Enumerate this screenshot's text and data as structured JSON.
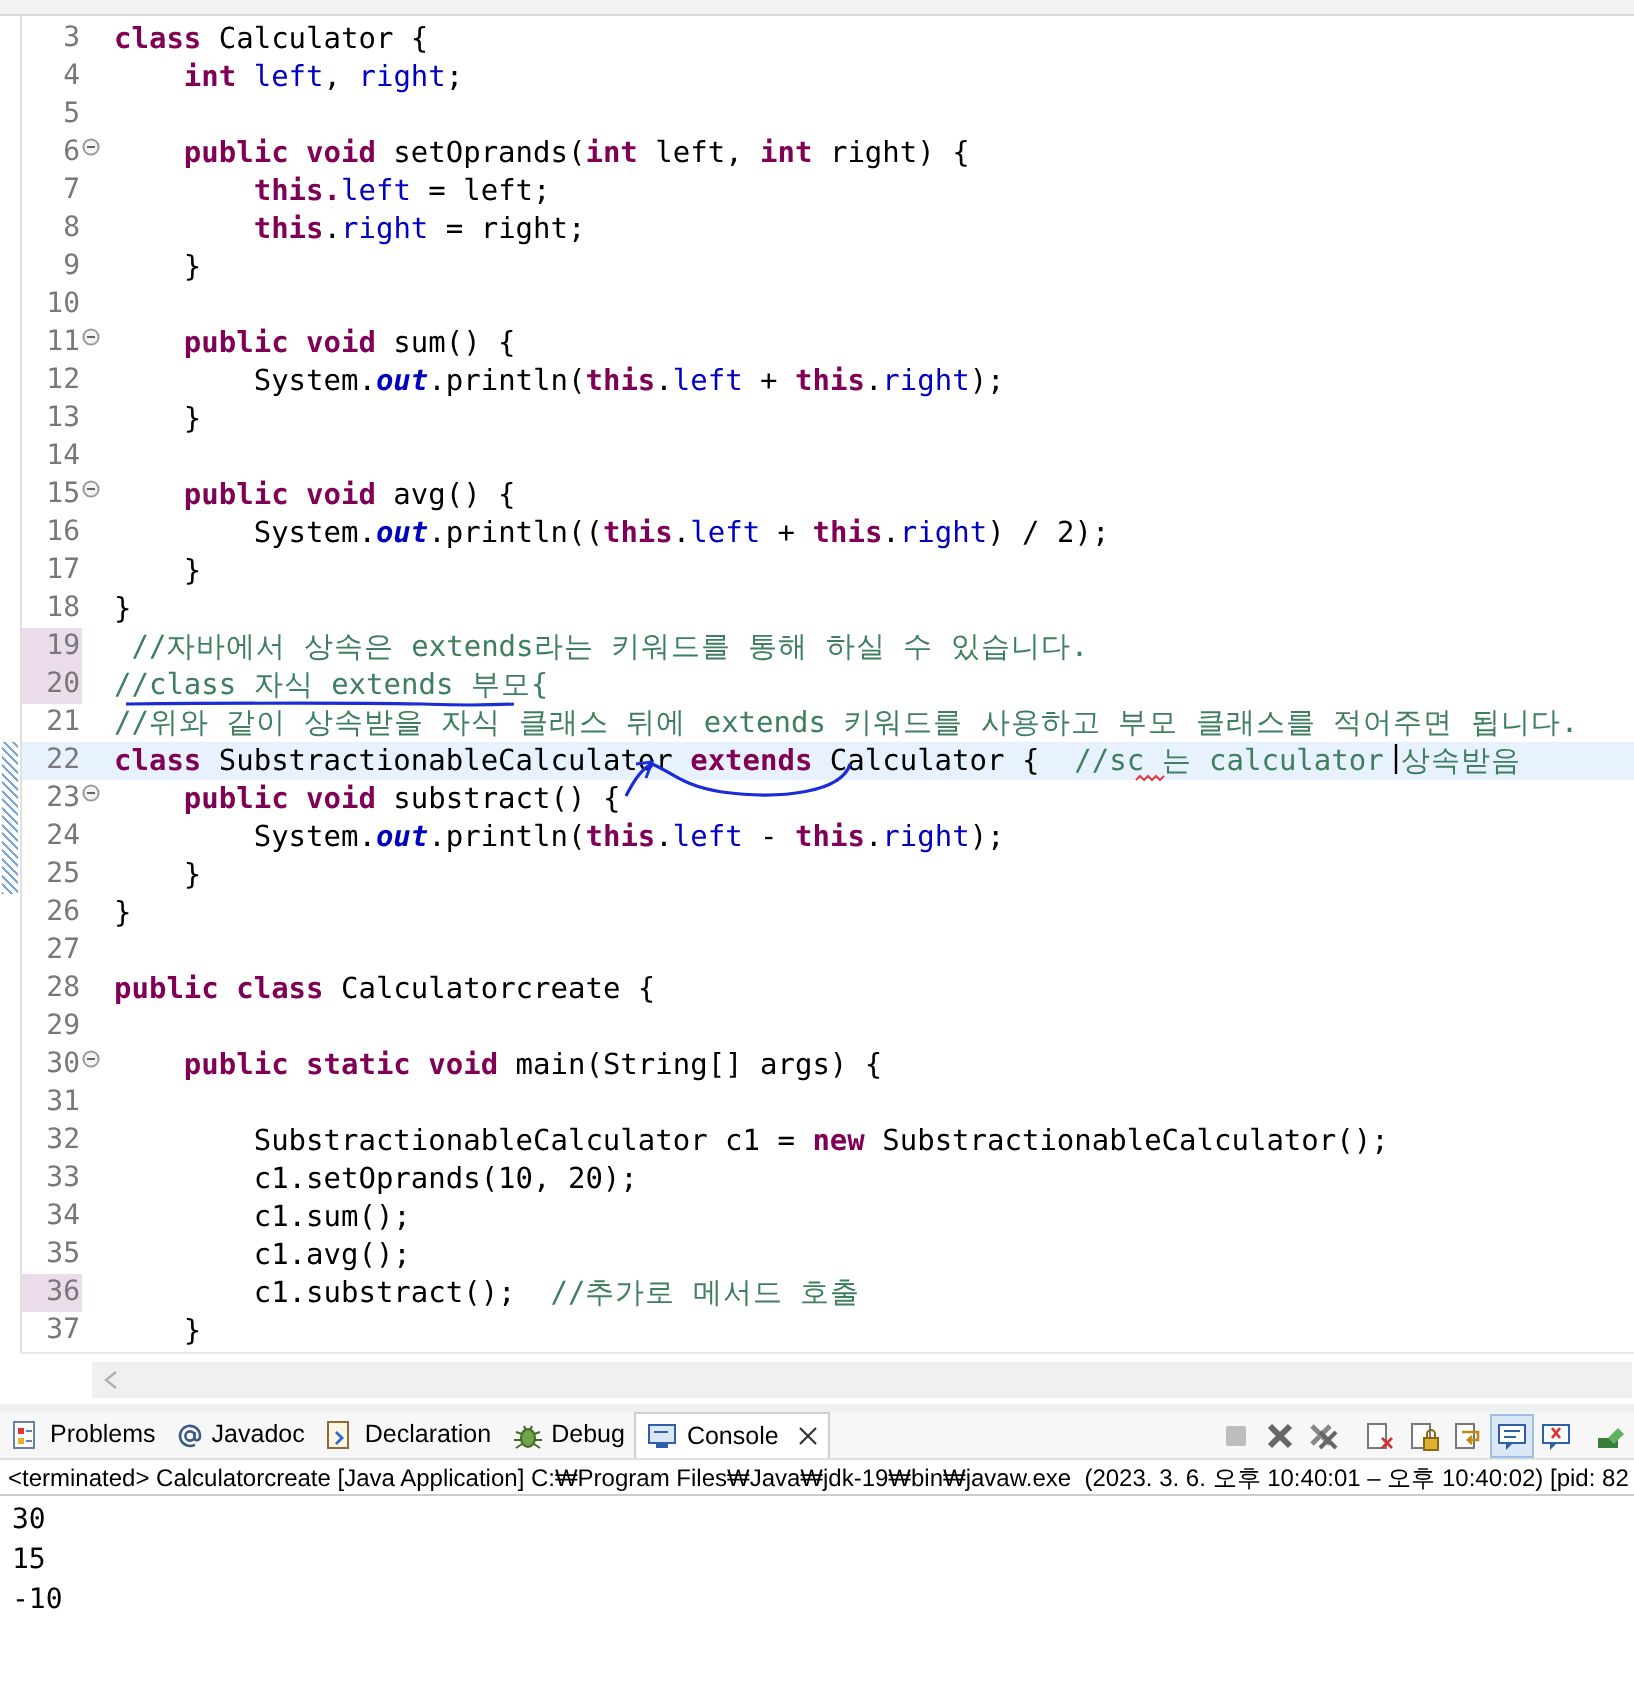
{
  "editor": {
    "lines": [
      {
        "number": "3",
        "fold": false,
        "changed": false,
        "current": false,
        "tokens": [
          {
            "kind": "keyword",
            "text": "class"
          },
          {
            "kind": "plain",
            "text": " Calculator {"
          }
        ]
      },
      {
        "number": "4",
        "fold": false,
        "changed": false,
        "current": false,
        "tokens": [
          {
            "kind": "keyword",
            "text": "    int"
          },
          {
            "kind": "field",
            "text": " left"
          },
          {
            "kind": "plain",
            "text": ", "
          },
          {
            "kind": "field",
            "text": "right"
          },
          {
            "kind": "plain",
            "text": ";"
          }
        ]
      },
      {
        "number": "5",
        "fold": false,
        "changed": false,
        "current": false
      },
      {
        "number": "6",
        "fold": true,
        "changed": false,
        "current": false,
        "tokens": [
          {
            "kind": "keyword",
            "text": "    public void"
          },
          {
            "kind": "plain",
            "text": " setOprands("
          },
          {
            "kind": "keyword",
            "text": "int"
          },
          {
            "kind": "plain",
            "text": " left, "
          },
          {
            "kind": "keyword",
            "text": "int"
          },
          {
            "kind": "plain",
            "text": " right) {"
          }
        ]
      },
      {
        "number": "7",
        "fold": false,
        "changed": false,
        "current": false,
        "tokens": [
          {
            "kind": "keyword",
            "text": "        this."
          },
          {
            "kind": "field",
            "text": "left"
          },
          {
            "kind": "plain",
            "text": " = left;"
          }
        ]
      },
      {
        "number": "8",
        "fold": false,
        "changed": false,
        "current": false,
        "tokens": [
          {
            "kind": "keyword",
            "text": "        this"
          },
          {
            "kind": "plain",
            "text": "."
          },
          {
            "kind": "field",
            "text": "right"
          },
          {
            "kind": "plain",
            "text": " = right;"
          }
        ]
      },
      {
        "number": "9",
        "fold": false,
        "changed": false,
        "current": false,
        "tokens": [
          {
            "kind": "plain",
            "text": "    }"
          }
        ]
      },
      {
        "number": "10",
        "fold": false,
        "changed": false,
        "current": false
      },
      {
        "number": "11",
        "fold": true,
        "changed": false,
        "current": false,
        "tokens": [
          {
            "kind": "keyword",
            "text": "    public void"
          },
          {
            "kind": "plain",
            "text": " sum() {"
          }
        ]
      },
      {
        "number": "12",
        "fold": false,
        "changed": false,
        "current": false,
        "tokens": [
          {
            "kind": "plain",
            "text": "        System."
          },
          {
            "kind": "static",
            "text": "out"
          },
          {
            "kind": "plain",
            "text": ".println("
          },
          {
            "kind": "keyword",
            "text": "this"
          },
          {
            "kind": "plain",
            "text": "."
          },
          {
            "kind": "field",
            "text": "left"
          },
          {
            "kind": "plain",
            "text": " + "
          },
          {
            "kind": "keyword",
            "text": "this"
          },
          {
            "kind": "plain",
            "text": "."
          },
          {
            "kind": "field",
            "text": "right"
          },
          {
            "kind": "plain",
            "text": ");"
          }
        ]
      },
      {
        "number": "13",
        "fold": false,
        "changed": false,
        "current": false,
        "tokens": [
          {
            "kind": "plain",
            "text": "    }"
          }
        ]
      },
      {
        "number": "14",
        "fold": false,
        "changed": false,
        "current": false
      },
      {
        "number": "15",
        "fold": true,
        "changed": false,
        "current": false,
        "tokens": [
          {
            "kind": "keyword",
            "text": "    public void"
          },
          {
            "kind": "plain",
            "text": " avg() {"
          }
        ]
      },
      {
        "number": "16",
        "fold": false,
        "changed": false,
        "current": false,
        "tokens": [
          {
            "kind": "plain",
            "text": "        System."
          },
          {
            "kind": "static",
            "text": "out"
          },
          {
            "kind": "plain",
            "text": ".println(("
          },
          {
            "kind": "keyword",
            "text": "this"
          },
          {
            "kind": "plain",
            "text": "."
          },
          {
            "kind": "field",
            "text": "left"
          },
          {
            "kind": "plain",
            "text": " + "
          },
          {
            "kind": "keyword",
            "text": "this"
          },
          {
            "kind": "plain",
            "text": "."
          },
          {
            "kind": "field",
            "text": "right"
          },
          {
            "kind": "plain",
            "text": ") / 2);"
          }
        ]
      },
      {
        "number": "17",
        "fold": false,
        "changed": false,
        "current": false,
        "tokens": [
          {
            "kind": "plain",
            "text": "    }"
          }
        ]
      },
      {
        "number": "18",
        "fold": false,
        "changed": false,
        "current": false,
        "tokens": [
          {
            "kind": "plain",
            "text": "}"
          }
        ]
      },
      {
        "number": "19",
        "fold": false,
        "changed": true,
        "current": false,
        "tokens": [
          {
            "kind": "comment",
            "text": " //자바에서 상속은 extends라는 키워드를 통해 하실 수 있습니다."
          }
        ]
      },
      {
        "number": "20",
        "fold": false,
        "changed": true,
        "current": false,
        "tokens": [
          {
            "kind": "comment",
            "text": "//class 자식 extends 부모{"
          }
        ]
      },
      {
        "number": "21",
        "fold": false,
        "changed": false,
        "current": false,
        "tokens": [
          {
            "kind": "comment",
            "text": "//위와 같이 상속받을 자식 클래스 뒤에 extends 키워드를 사용하고 부모 클래스를 적어주면 됩니다."
          }
        ]
      },
      {
        "number": "22",
        "fold": false,
        "changed": false,
        "current": true,
        "tokens": [
          {
            "kind": "keyword",
            "text": "class"
          },
          {
            "kind": "plain",
            "text": " SubstractionableCalculator "
          },
          {
            "kind": "keyword",
            "text": "extends"
          },
          {
            "kind": "plain",
            "text": " Calculator {  "
          },
          {
            "kind": "comment",
            "text": "//sc 는 calculator 상속받음"
          }
        ]
      },
      {
        "number": "23",
        "fold": true,
        "changed": false,
        "current": false,
        "tokens": [
          {
            "kind": "keyword",
            "text": "    public void"
          },
          {
            "kind": "plain",
            "text": " substract() {"
          }
        ]
      },
      {
        "number": "24",
        "fold": false,
        "changed": false,
        "current": false,
        "tokens": [
          {
            "kind": "plain",
            "text": "        System."
          },
          {
            "kind": "static",
            "text": "out"
          },
          {
            "kind": "plain",
            "text": ".println("
          },
          {
            "kind": "keyword",
            "text": "this"
          },
          {
            "kind": "plain",
            "text": "."
          },
          {
            "kind": "field",
            "text": "left"
          },
          {
            "kind": "plain",
            "text": " - "
          },
          {
            "kind": "keyword",
            "text": "this"
          },
          {
            "kind": "plain",
            "text": "."
          },
          {
            "kind": "field",
            "text": "right"
          },
          {
            "kind": "plain",
            "text": ");"
          }
        ]
      },
      {
        "number": "25",
        "fold": false,
        "changed": false,
        "current": false,
        "tokens": [
          {
            "kind": "plain",
            "text": "    }"
          }
        ]
      },
      {
        "number": "26",
        "fold": false,
        "changed": false,
        "current": false,
        "tokens": [
          {
            "kind": "plain",
            "text": "}"
          }
        ]
      },
      {
        "number": "27",
        "fold": false,
        "changed": false,
        "current": false
      },
      {
        "number": "28",
        "fold": false,
        "changed": false,
        "current": false,
        "tokens": [
          {
            "kind": "keyword",
            "text": "public class"
          },
          {
            "kind": "plain",
            "text": " Calculatorcreate {"
          }
        ]
      },
      {
        "number": "29",
        "fold": false,
        "changed": false,
        "current": false
      },
      {
        "number": "30",
        "fold": true,
        "changed": false,
        "current": false,
        "tokens": [
          {
            "kind": "keyword",
            "text": "    public static void"
          },
          {
            "kind": "plain",
            "text": " main(String[] args) {"
          }
        ]
      },
      {
        "number": "31",
        "fold": false,
        "changed": false,
        "current": false
      },
      {
        "number": "32",
        "fold": false,
        "changed": false,
        "current": false,
        "tokens": [
          {
            "kind": "plain",
            "text": "        SubstractionableCalculator c1 = "
          },
          {
            "kind": "keyword",
            "text": "new"
          },
          {
            "kind": "plain",
            "text": " SubstractionableCalculator();"
          }
        ]
      },
      {
        "number": "33",
        "fold": false,
        "changed": false,
        "current": false,
        "tokens": [
          {
            "kind": "plain",
            "text": "        c1.setOprands(10, 20);"
          }
        ]
      },
      {
        "number": "34",
        "fold": false,
        "changed": false,
        "current": false,
        "tokens": [
          {
            "kind": "plain",
            "text": "        c1.sum();"
          }
        ]
      },
      {
        "number": "35",
        "fold": false,
        "changed": false,
        "current": false,
        "tokens": [
          {
            "kind": "plain",
            "text": "        c1.avg();"
          }
        ]
      },
      {
        "number": "36",
        "fold": false,
        "changed": true,
        "current": false,
        "tokens": [
          {
            "kind": "plain",
            "text": "        c1.substract();  "
          },
          {
            "kind": "comment",
            "text": "//추가로 메서드 호출"
          }
        ]
      },
      {
        "number": "37",
        "fold": false,
        "changed": false,
        "current": false,
        "tokens": [
          {
            "kind": "plain",
            "text": "    }"
          }
        ]
      }
    ]
  },
  "console": {
    "tabs": [
      {
        "kind": "problems",
        "label": "Problems",
        "selected": false,
        "closable": false
      },
      {
        "kind": "javadoc",
        "label": "Javadoc",
        "selected": false,
        "closable": false
      },
      {
        "kind": "declaration",
        "label": "Declaration",
        "selected": false,
        "closable": false
      },
      {
        "kind": "debug",
        "label": "Debug",
        "selected": false,
        "closable": false
      },
      {
        "kind": "console",
        "label": "Console",
        "selected": true,
        "closable": true
      }
    ],
    "toolbar": [
      {
        "kind": "stop",
        "on": false
      },
      {
        "kind": "remove",
        "on": false
      },
      {
        "kind": "remove-all",
        "on": false
      },
      {
        "kind": "clear",
        "on": false
      },
      {
        "kind": "lock",
        "on": false
      },
      {
        "kind": "wrap",
        "on": false
      },
      {
        "kind": "show-out",
        "on": true
      },
      {
        "kind": "show-err",
        "on": false
      },
      {
        "kind": "pin",
        "on": false
      }
    ],
    "status": "<terminated> Calculatorcreate [Java Application] C:₩Program Files₩Java₩jdk-19₩bin₩javaw.exe  (2023. 3. 6. 오후 10:40:01 – 오후 10:40:02) [pid: 82",
    "output": [
      "30",
      "15",
      "-10"
    ]
  }
}
